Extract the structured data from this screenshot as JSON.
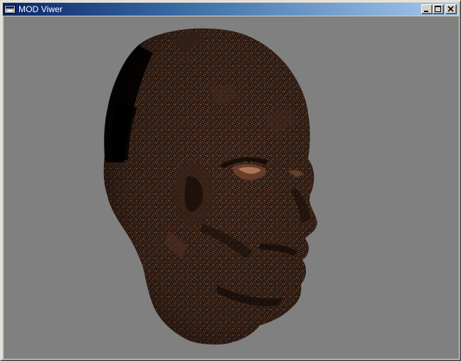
{
  "window": {
    "title": "MOD Viwer",
    "icon": "app-window-icon",
    "controls": {
      "minimize_icon": "minimize-icon",
      "maximize_icon": "maximize-icon",
      "close_icon": "close-icon"
    }
  },
  "viewport": {
    "background_color": "#808080",
    "model": "textured-3d-head",
    "model_base_color": "#2a1a12",
    "model_texture_color": "#8a5a40"
  }
}
